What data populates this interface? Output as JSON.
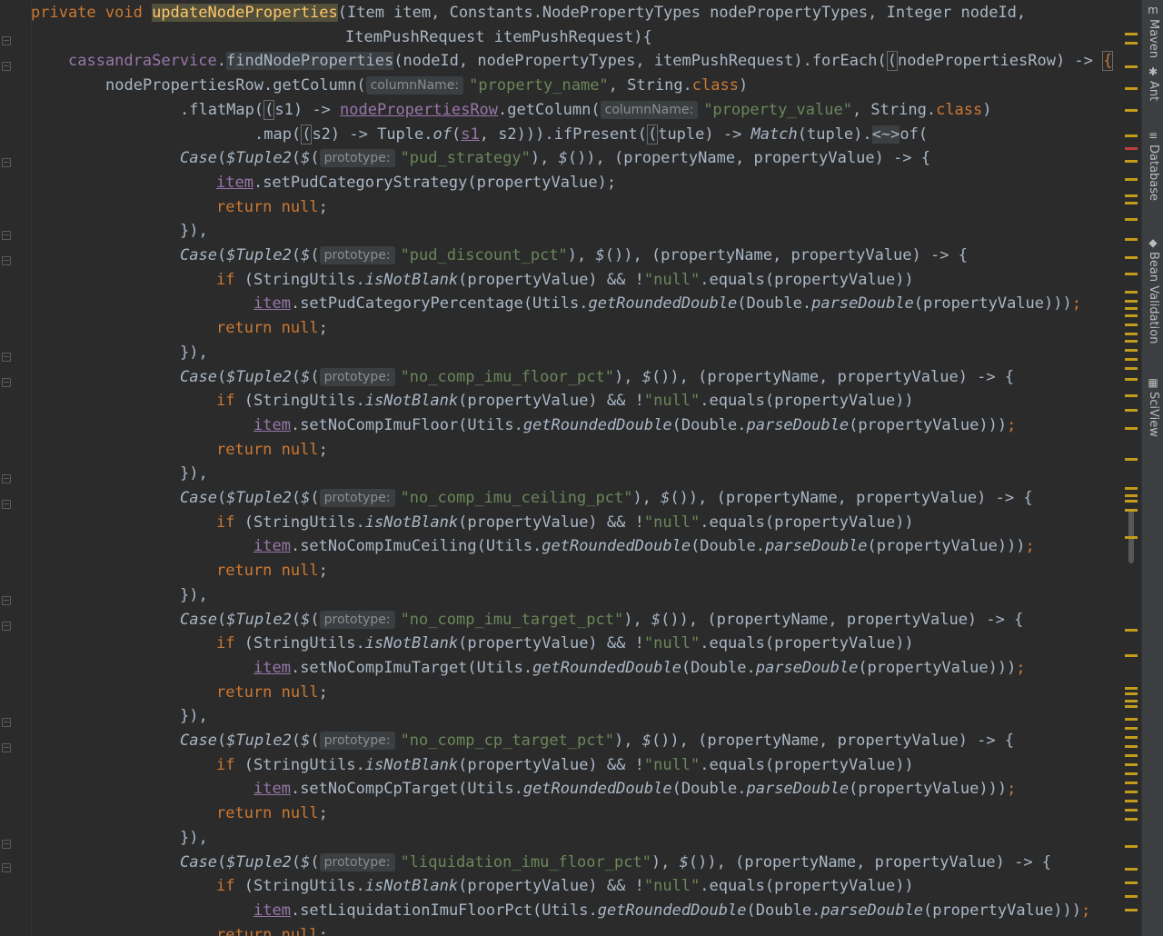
{
  "editor": {
    "lines": [
      {
        "indent": 34,
        "tokens": [
          {
            "t": "private void ",
            "c": "kw"
          },
          {
            "t": "updateNodeProperties",
            "c": "fn hlf"
          },
          {
            "t": "(Item item, Constants.NodePropertyTypes nodePropertyTypes, Integer nodeId,"
          }
        ]
      },
      {
        "indent": 380,
        "tokens": [
          {
            "t": "ItemPushRequest itemPushRequest){"
          }
        ]
      },
      {
        "indent": 75,
        "tokens": [
          {
            "t": "cassandraService",
            "c": "fld"
          },
          {
            "t": "."
          },
          {
            "t": "findNodeProperties",
            "c": "hl"
          },
          {
            "t": "(nodeId, nodePropertyTypes, itemPushRequest).forEach("
          },
          {
            "t": "(",
            "c": "bracket"
          },
          {
            "t": "nodePropertiesRow) -> "
          },
          {
            "t": "{",
            "c": "kw bracket"
          }
        ]
      },
      {
        "indent": 116,
        "tokens": [
          {
            "t": "nodePropertiesRow.getColumn("
          },
          {
            "hint": "columnName:"
          },
          {
            "t": "\"property_name\"",
            "c": "str"
          },
          {
            "t": ", String."
          },
          {
            "t": "class",
            "c": "kw"
          },
          {
            "t": ")"
          }
        ]
      },
      {
        "indent": 198,
        "tokens": [
          {
            "t": ".flatMap("
          },
          {
            "t": "(",
            "c": "bracket"
          },
          {
            "t": "s1) -> "
          },
          {
            "t": "nodePropertiesRow",
            "c": "fld ul"
          },
          {
            "t": ".getColumn("
          },
          {
            "hint": "columnName:"
          },
          {
            "t": "\"property_value\"",
            "c": "str"
          },
          {
            "t": ", String."
          },
          {
            "t": "class",
            "c": "kw"
          },
          {
            "t": ")"
          }
        ]
      },
      {
        "indent": 280,
        "tokens": [
          {
            "t": ".map("
          },
          {
            "t": "(",
            "c": "bracket"
          },
          {
            "t": "s2) -> Tuple."
          },
          {
            "t": "of",
            "c": "it"
          },
          {
            "t": "("
          },
          {
            "t": "s1",
            "c": "fld ul"
          },
          {
            "t": ", s2))).ifPresent("
          },
          {
            "t": "(",
            "c": "bracket"
          },
          {
            "t": "tuple) -> "
          },
          {
            "t": "Match",
            "c": "it"
          },
          {
            "t": "(tuple)."
          },
          {
            "t": "<~>",
            "c": "hl"
          },
          {
            "t": "of("
          }
        ]
      },
      {
        "indent": 198,
        "tokens": [
          {
            "t": "Case",
            "c": "it"
          },
          {
            "t": "("
          },
          {
            "t": "$Tuple2",
            "c": "it"
          },
          {
            "t": "("
          },
          {
            "t": "$",
            "c": "it"
          },
          {
            "t": "("
          },
          {
            "hint": "prototype:"
          },
          {
            "t": "\"pud_strategy\"",
            "c": "str"
          },
          {
            "t": "), "
          },
          {
            "t": "$",
            "c": "it"
          },
          {
            "t": "()), (propertyName, propertyValue) -> {"
          }
        ]
      },
      {
        "indent": 238,
        "tokens": [
          {
            "t": "item",
            "c": "fld ul"
          },
          {
            "t": ".setPudCategoryStrategy(propertyValue);"
          }
        ]
      },
      {
        "indent": 238,
        "tokens": [
          {
            "t": "return null",
            "c": "kw"
          },
          {
            "t": ";"
          }
        ]
      },
      {
        "indent": 198,
        "tokens": [
          {
            "t": "}),"
          }
        ]
      },
      {
        "indent": 198,
        "tokens": [
          {
            "t": "Case",
            "c": "it"
          },
          {
            "t": "("
          },
          {
            "t": "$Tuple2",
            "c": "it"
          },
          {
            "t": "("
          },
          {
            "t": "$",
            "c": "it"
          },
          {
            "t": "("
          },
          {
            "hint": "prototype:"
          },
          {
            "t": "\"pud_discount_pct\"",
            "c": "str"
          },
          {
            "t": "), "
          },
          {
            "t": "$",
            "c": "it"
          },
          {
            "t": "()), (propertyName, propertyValue) -> {"
          }
        ]
      },
      {
        "indent": 238,
        "tokens": [
          {
            "t": "if ",
            "c": "kw"
          },
          {
            "t": "(StringUtils."
          },
          {
            "t": "isNotBlank",
            "c": "it"
          },
          {
            "t": "(propertyValue) && !"
          },
          {
            "t": "\"null\"",
            "c": "str"
          },
          {
            "t": ".equals(propertyValue))"
          }
        ]
      },
      {
        "indent": 279,
        "tokens": [
          {
            "t": "item",
            "c": "fld ul"
          },
          {
            "t": ".setPudCategoryPercentage(Utils."
          },
          {
            "t": "getRoundedDouble",
            "c": "it"
          },
          {
            "t": "(Double."
          },
          {
            "t": "parseDouble",
            "c": "it"
          },
          {
            "t": "(propertyValue)))"
          },
          {
            "t": ";",
            "c": "kw"
          }
        ]
      },
      {
        "indent": 238,
        "tokens": [
          {
            "t": "return null",
            "c": "kw"
          },
          {
            "t": ";"
          }
        ]
      },
      {
        "indent": 198,
        "tokens": [
          {
            "t": "}),"
          }
        ]
      },
      {
        "indent": 198,
        "tokens": [
          {
            "t": "Case",
            "c": "it"
          },
          {
            "t": "("
          },
          {
            "t": "$Tuple2",
            "c": "it"
          },
          {
            "t": "("
          },
          {
            "t": "$",
            "c": "it"
          },
          {
            "t": "("
          },
          {
            "hint": "prototype:"
          },
          {
            "t": "\"no_comp_imu_floor_pct\"",
            "c": "str"
          },
          {
            "t": "), "
          },
          {
            "t": "$",
            "c": "it"
          },
          {
            "t": "()), (propertyName, propertyValue) -> {"
          }
        ]
      },
      {
        "indent": 238,
        "tokens": [
          {
            "t": "if ",
            "c": "kw"
          },
          {
            "t": "(StringUtils."
          },
          {
            "t": "isNotBlank",
            "c": "it"
          },
          {
            "t": "(propertyValue) && !"
          },
          {
            "t": "\"null\"",
            "c": "str"
          },
          {
            "t": ".equals(propertyValue))"
          }
        ]
      },
      {
        "indent": 279,
        "tokens": [
          {
            "t": "item",
            "c": "fld ul"
          },
          {
            "t": ".setNoCompImuFloor(Utils."
          },
          {
            "t": "getRoundedDouble",
            "c": "it"
          },
          {
            "t": "(Double."
          },
          {
            "t": "parseDouble",
            "c": "it"
          },
          {
            "t": "(propertyValue)))"
          },
          {
            "t": ";",
            "c": "kw"
          }
        ]
      },
      {
        "indent": 238,
        "tokens": [
          {
            "t": "return null",
            "c": "kw"
          },
          {
            "t": ";"
          }
        ]
      },
      {
        "indent": 198,
        "tokens": [
          {
            "t": "}),"
          }
        ]
      },
      {
        "indent": 198,
        "tokens": [
          {
            "t": "Case",
            "c": "it"
          },
          {
            "t": "("
          },
          {
            "t": "$Tuple2",
            "c": "it"
          },
          {
            "t": "("
          },
          {
            "t": "$",
            "c": "it"
          },
          {
            "t": "("
          },
          {
            "hint": "prototype:"
          },
          {
            "t": "\"no_comp_imu_ceiling_pct\"",
            "c": "str"
          },
          {
            "t": "), "
          },
          {
            "t": "$",
            "c": "it"
          },
          {
            "t": "()), (propertyName, propertyValue) -> {"
          }
        ]
      },
      {
        "indent": 238,
        "tokens": [
          {
            "t": "if ",
            "c": "kw"
          },
          {
            "t": "(StringUtils."
          },
          {
            "t": "isNotBlank",
            "c": "it"
          },
          {
            "t": "(propertyValue) && !"
          },
          {
            "t": "\"null\"",
            "c": "str"
          },
          {
            "t": ".equals(propertyValue))"
          }
        ]
      },
      {
        "indent": 279,
        "tokens": [
          {
            "t": "item",
            "c": "fld ul"
          },
          {
            "t": ".setNoCompImuCeiling(Utils."
          },
          {
            "t": "getRoundedDouble",
            "c": "it"
          },
          {
            "t": "(Double."
          },
          {
            "t": "parseDouble",
            "c": "it"
          },
          {
            "t": "(propertyValue)))"
          },
          {
            "t": ";",
            "c": "kw"
          }
        ]
      },
      {
        "indent": 238,
        "tokens": [
          {
            "t": "return null",
            "c": "kw"
          },
          {
            "t": ";"
          }
        ]
      },
      {
        "indent": 198,
        "tokens": [
          {
            "t": "}),"
          }
        ]
      },
      {
        "indent": 198,
        "tokens": [
          {
            "t": "Case",
            "c": "it"
          },
          {
            "t": "("
          },
          {
            "t": "$Tuple2",
            "c": "it"
          },
          {
            "t": "("
          },
          {
            "t": "$",
            "c": "it"
          },
          {
            "t": "("
          },
          {
            "hint": "prototype:"
          },
          {
            "t": "\"no_comp_imu_target_pct\"",
            "c": "str"
          },
          {
            "t": "), "
          },
          {
            "t": "$",
            "c": "it"
          },
          {
            "t": "()), (propertyName, propertyValue) -> {"
          }
        ]
      },
      {
        "indent": 238,
        "tokens": [
          {
            "t": "if ",
            "c": "kw"
          },
          {
            "t": "(StringUtils."
          },
          {
            "t": "isNotBlank",
            "c": "it"
          },
          {
            "t": "(propertyValue) && !"
          },
          {
            "t": "\"null\"",
            "c": "str"
          },
          {
            "t": ".equals(propertyValue))"
          }
        ]
      },
      {
        "indent": 279,
        "tokens": [
          {
            "t": "item",
            "c": "fld ul"
          },
          {
            "t": ".setNoCompImuTarget(Utils."
          },
          {
            "t": "getRoundedDouble",
            "c": "it"
          },
          {
            "t": "(Double."
          },
          {
            "t": "parseDouble",
            "c": "it"
          },
          {
            "t": "(propertyValue)))"
          },
          {
            "t": ";",
            "c": "kw"
          }
        ]
      },
      {
        "indent": 238,
        "tokens": [
          {
            "t": "return null",
            "c": "kw"
          },
          {
            "t": ";"
          }
        ]
      },
      {
        "indent": 198,
        "tokens": [
          {
            "t": "}),"
          }
        ]
      },
      {
        "indent": 198,
        "tokens": [
          {
            "t": "Case",
            "c": "it"
          },
          {
            "t": "("
          },
          {
            "t": "$Tuple2",
            "c": "it"
          },
          {
            "t": "("
          },
          {
            "t": "$",
            "c": "it"
          },
          {
            "t": "("
          },
          {
            "hint": "prototype:"
          },
          {
            "t": "\"no_comp_cp_target_pct\"",
            "c": "str"
          },
          {
            "t": "), "
          },
          {
            "t": "$",
            "c": "it"
          },
          {
            "t": "()), (propertyName, propertyValue) -> {"
          }
        ]
      },
      {
        "indent": 238,
        "tokens": [
          {
            "t": "if ",
            "c": "kw"
          },
          {
            "t": "(StringUtils."
          },
          {
            "t": "isNotBlank",
            "c": "it"
          },
          {
            "t": "(propertyValue) && !"
          },
          {
            "t": "\"null\"",
            "c": "str"
          },
          {
            "t": ".equals(propertyValue))"
          }
        ]
      },
      {
        "indent": 279,
        "tokens": [
          {
            "t": "item",
            "c": "fld ul"
          },
          {
            "t": ".setNoCompCpTarget(Utils."
          },
          {
            "t": "getRoundedDouble",
            "c": "it"
          },
          {
            "t": "(Double."
          },
          {
            "t": "parseDouble",
            "c": "it"
          },
          {
            "t": "(propertyValue)))"
          },
          {
            "t": ";",
            "c": "kw"
          }
        ]
      },
      {
        "indent": 238,
        "tokens": [
          {
            "t": "return null",
            "c": "kw"
          },
          {
            "t": ";"
          }
        ]
      },
      {
        "indent": 198,
        "tokens": [
          {
            "t": "}),"
          }
        ]
      },
      {
        "indent": 198,
        "tokens": [
          {
            "t": "Case",
            "c": "it"
          },
          {
            "t": "("
          },
          {
            "t": "$Tuple2",
            "c": "it"
          },
          {
            "t": "("
          },
          {
            "t": "$",
            "c": "it"
          },
          {
            "t": "("
          },
          {
            "hint": "prototype:"
          },
          {
            "t": "\"liquidation_imu_floor_pct\"",
            "c": "str"
          },
          {
            "t": "), "
          },
          {
            "t": "$",
            "c": "it"
          },
          {
            "t": "()), (propertyName, propertyValue) -> {"
          }
        ]
      },
      {
        "indent": 238,
        "tokens": [
          {
            "t": "if ",
            "c": "kw"
          },
          {
            "t": "(StringUtils."
          },
          {
            "t": "isNotBlank",
            "c": "it"
          },
          {
            "t": "(propertyValue) && !"
          },
          {
            "t": "\"null\"",
            "c": "str"
          },
          {
            "t": ".equals(propertyValue))"
          }
        ]
      },
      {
        "indent": 279,
        "tokens": [
          {
            "t": "item",
            "c": "fld ul"
          },
          {
            "t": ".setLiquidationImuFloorPct(Utils."
          },
          {
            "t": "getRoundedDouble",
            "c": "it"
          },
          {
            "t": "(Double."
          },
          {
            "t": "parseDouble",
            "c": "it"
          },
          {
            "t": "(propertyValue)))"
          },
          {
            "t": ";",
            "c": "kw"
          }
        ]
      },
      {
        "indent": 238,
        "tokens": [
          {
            "t": "return null",
            "c": "kw"
          },
          {
            "t": ";"
          }
        ]
      }
    ]
  },
  "tool_windows": [
    {
      "label": "Maven",
      "icon": "maven-icon",
      "glyph": "m"
    },
    {
      "label": "Ant",
      "icon": "ant-icon",
      "glyph": "✱"
    },
    {
      "label": "Database",
      "icon": "database-icon",
      "glyph": "≡"
    },
    {
      "label": "Bean Validation",
      "icon": "bean-validation-icon",
      "glyph": "◆"
    },
    {
      "label": "SciView",
      "icon": "sciview-icon",
      "glyph": "▦"
    }
  ],
  "colors": {
    "background": "#2b2b2b",
    "keyword": "#cc7832",
    "function": "#ffc66d",
    "string": "#6a8759",
    "field": "#9876aa",
    "text": "#a9b7c6",
    "marker": "#c29c1a"
  }
}
